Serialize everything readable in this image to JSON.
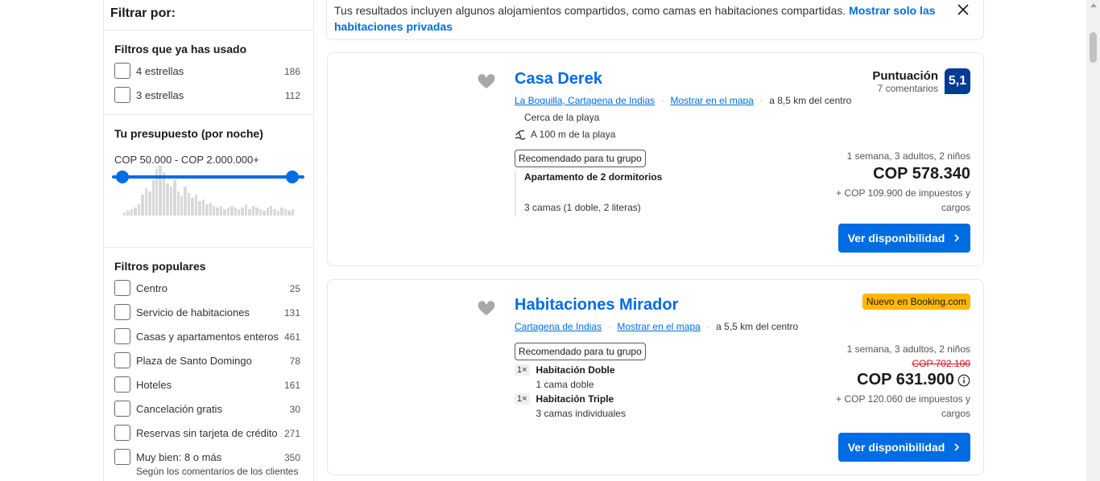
{
  "sidebar": {
    "title": "Filtrar por:",
    "used_filters": {
      "heading": "Filtros que ya has usado",
      "items": [
        {
          "label": "4 estrellas",
          "count": "186"
        },
        {
          "label": "3 estrellas",
          "count": "112"
        }
      ]
    },
    "budget": {
      "heading": "Tu presupuesto (por noche)",
      "range": "COP 50.000 - COP 2.000.000+"
    },
    "popular": {
      "heading": "Filtros populares",
      "items": [
        {
          "label": "Centro",
          "count": "25"
        },
        {
          "label": "Servicio de habitaciones",
          "count": "131"
        },
        {
          "label": "Casas y apartamentos enteros",
          "count": "461"
        },
        {
          "label": "Plaza de Santo Domingo",
          "count": "78"
        },
        {
          "label": "Hoteles",
          "count": "161"
        },
        {
          "label": "Cancelación gratis",
          "count": "30"
        },
        {
          "label": "Reservas sin tarjeta de crédito",
          "count": "271"
        },
        {
          "label": "Muy bien: 8 o más",
          "count": "350",
          "sub": "Según los comentarios de los clientes"
        }
      ]
    }
  },
  "notice": {
    "text": "Tus resultados incluyen algunos alojamientos compartidos, como camas en habitaciones compartidas.",
    "link": "Mostrar solo las habitaciones privadas"
  },
  "results": [
    {
      "name": "Casa Derek",
      "location": "La Boquilla, Cartagena de Indias",
      "map_link": "Mostrar en el mapa",
      "distance": "a 8,5 km del centro",
      "tag1": "Cerca de la playa",
      "tag2": "A 100 m de la playa",
      "recommended": "Recomendado para tu grupo",
      "room_title": "Apartamento de 2 dormitorios",
      "room_beds": "3 camas (1 doble, 2 literas)",
      "score_label": "Puntuación",
      "reviews": "7 comentarios",
      "score": "5,1",
      "stay": "1 semana, 3 adultos, 2 niños",
      "price": "COP 578.340",
      "taxes_1": "+ COP 109.900 de impuestos y",
      "taxes_2": "cargos",
      "cta": "Ver disponibilidad"
    },
    {
      "name": "Habitaciones Mirador",
      "location": "Cartagena de Indias",
      "map_link": "Mostrar en el mapa",
      "distance": "a 5,5 km del centro",
      "recommended": "Recomendado para tu grupo",
      "rooms": [
        {
          "qty": "1×",
          "title": "Habitación Doble",
          "beds": "1 cama doble"
        },
        {
          "qty": "1×",
          "title": "Habitación Triple",
          "beds": "3 camas individuales"
        }
      ],
      "new_badge": "Nuevo en Booking.com",
      "stay": "1 semana, 3 adultos, 2 niños",
      "old_price": "COP 702.100",
      "price": "COP 631.900",
      "taxes_1": "+ COP 120.060 de impuestos y",
      "taxes_2": "cargos",
      "cta": "Ver disponibilidad"
    }
  ],
  "histogram": [
    4,
    6,
    8,
    10,
    14,
    26,
    34,
    30,
    44,
    58,
    62,
    54,
    40,
    36,
    44,
    30,
    24,
    36,
    28,
    22,
    26,
    18,
    20,
    14,
    16,
    12,
    10,
    12,
    8,
    10,
    12,
    10,
    8,
    10,
    14,
    8,
    12,
    10,
    8,
    6,
    10,
    12,
    8,
    6,
    10,
    8,
    6,
    8
  ],
  "icons": {
    "heart": "heart-icon",
    "close": "close-icon",
    "beach": "beach-icon",
    "info": "info-icon",
    "chevron": "chevron-right-icon"
  },
  "colors": {
    "accent": "#006ce4",
    "score": "#003b95",
    "badge": "#ffb700",
    "strike": "#d4111e"
  }
}
